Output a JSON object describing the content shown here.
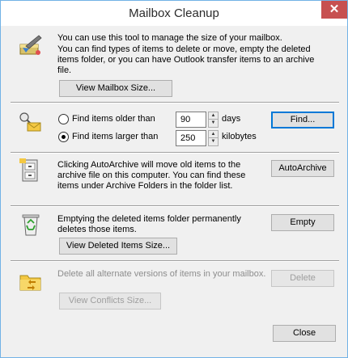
{
  "window": {
    "title": "Mailbox Cleanup",
    "close_glyph": "✕"
  },
  "mailbox": {
    "intro": "You can use this tool to manage the size of your mailbox.",
    "description": "You can find types of items to delete or move, empty the deleted items folder, or you can have Outlook transfer items to an archive file.",
    "view_size_label": "View Mailbox Size...",
    "icon": "broom-cleanup-icon"
  },
  "find": {
    "icon": "find-search-icon",
    "option_older_label": "Find items older than",
    "option_older_value": "90",
    "option_older_unit": "days",
    "option_larger_label": "Find items larger than",
    "option_larger_value": "250",
    "option_larger_unit": "kilobytes",
    "selected": "larger",
    "find_label": "Find..."
  },
  "archive": {
    "icon": "archive-cabinet-icon",
    "description": "Clicking AutoArchive will move old items to the archive file on this computer. You can find these items under Archive Folders in the folder list.",
    "button_label": "AutoArchive"
  },
  "deleted": {
    "icon": "recycle-bin-icon",
    "description": "Emptying the deleted items folder permanently deletes those items.",
    "empty_label": "Empty",
    "view_size_label": "View Deleted Items Size..."
  },
  "conflicts": {
    "icon": "conflict-folder-icon",
    "description": "Delete all alternate versions of items in your mailbox.",
    "delete_label": "Delete",
    "view_size_label": "View Conflicts Size..."
  },
  "footer": {
    "close_label": "Close"
  },
  "colors": {
    "accent": "#0078d7",
    "title_close_bg": "#c75050",
    "window_border": "#72b2e6"
  }
}
